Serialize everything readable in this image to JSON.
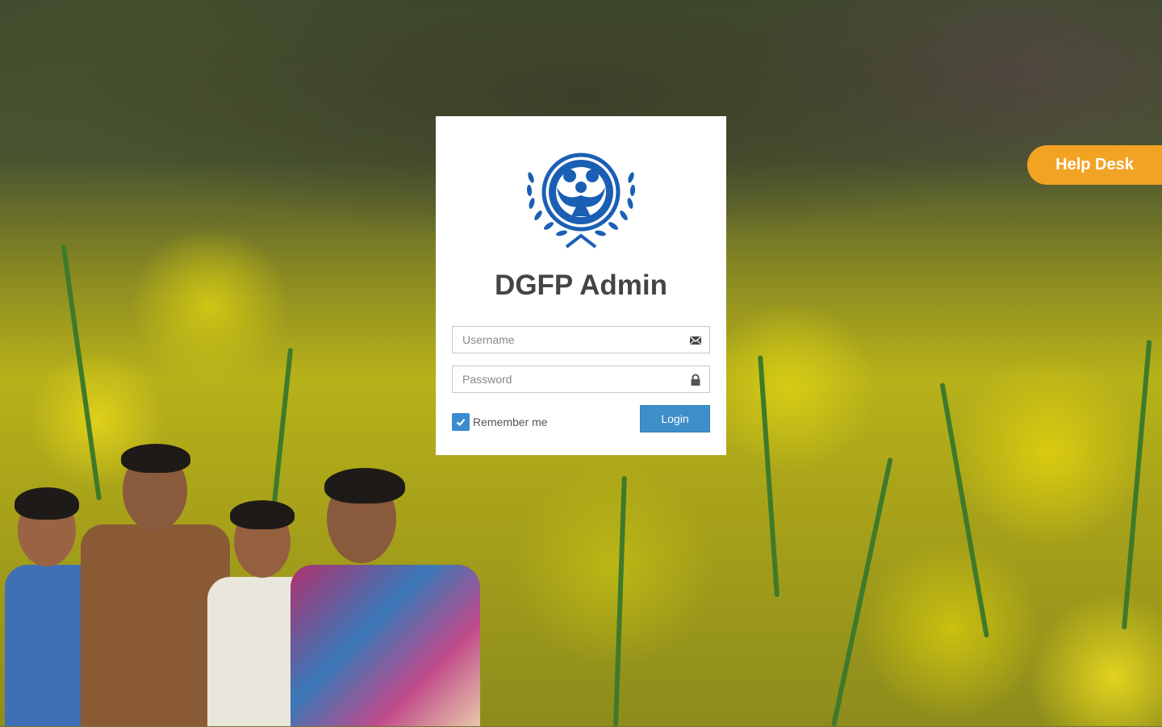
{
  "app": {
    "title": "DGFP Admin"
  },
  "login": {
    "username_placeholder": "Username",
    "password_placeholder": "Password",
    "remember_label": "Remember me",
    "remember_checked": true,
    "login_label": "Login"
  },
  "helpdesk": {
    "label": "Help Desk"
  },
  "colors": {
    "accent": "#3d8fc9",
    "helpdesk": "#f3a324",
    "logo": "#1a5fb4",
    "title_text": "#444444"
  },
  "icons": {
    "username": "envelope-icon",
    "password": "lock-icon",
    "checkbox": "check-icon",
    "logo": "dgfp-emblem"
  }
}
